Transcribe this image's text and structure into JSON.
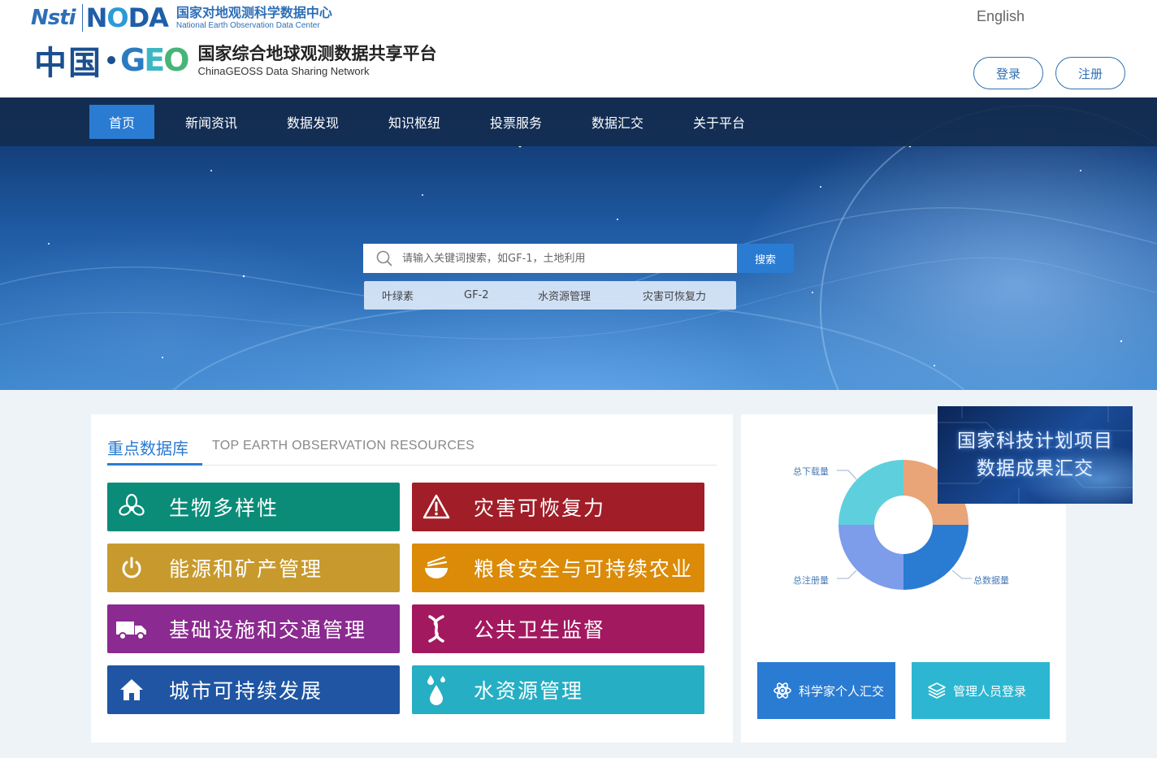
{
  "header": {
    "nsti_logo": "Nsti",
    "noda_logo": {
      "prefix": "N",
      "o": "O",
      "suffix": "DA"
    },
    "noda_cn": "国家对地观测科学数据中心",
    "noda_en": "National Earth Observation Data Center",
    "china_logo": "中国",
    "geo_logo": {
      "g": "G",
      "e": "E",
      "o": "O"
    },
    "geo_cn": "国家综合地球观测数据共享平台",
    "geo_en": "ChinaGEOSS Data Sharing Network",
    "language": "English",
    "login": "登录",
    "register": "注册"
  },
  "nav": {
    "items": [
      {
        "label": "首页",
        "active": true
      },
      {
        "label": "新闻资讯"
      },
      {
        "label": "数据发现"
      },
      {
        "label": "知识枢纽"
      },
      {
        "label": "投票服务"
      },
      {
        "label": "数据汇交"
      },
      {
        "label": "关于平台"
      }
    ]
  },
  "search": {
    "placeholder": "请输入关键词搜索，如GF-1，土地利用",
    "button": "搜索",
    "icon": "search-icon",
    "hot_tags": [
      "叶绿素",
      "GF-2",
      "水资源管理",
      "灾害可恢复力"
    ]
  },
  "resources": {
    "title": "重点数据库",
    "subtitle": "TOP EARTH OBSERVATION RESOURCES",
    "tiles": [
      {
        "label": "生物多样性",
        "color": "#0a8c78",
        "icon": "biodiversity-icon"
      },
      {
        "label": "灾害可恢复力",
        "color": "#a11d27",
        "icon": "warning-icon"
      },
      {
        "label": "能源和矿产管理",
        "color": "#c89a2e",
        "icon": "power-icon"
      },
      {
        "label": "粮食安全与可持续农业",
        "color": "#db8b07",
        "icon": "food-bowl-icon"
      },
      {
        "label": "基础设施和交通管理",
        "color": "#8b2a90",
        "icon": "truck-icon"
      },
      {
        "label": "公共卫生监督",
        "color": "#a3195f",
        "icon": "dna-icon"
      },
      {
        "label": "城市可持续发展",
        "color": "#1f55a3",
        "icon": "home-icon"
      },
      {
        "label": "水资源管理",
        "color": "#26aec4",
        "icon": "water-drops-icon"
      }
    ]
  },
  "stats": {
    "chart_data": {
      "type": "pie",
      "categories": [
        "总下载量",
        "总数据量",
        "总注册量"
      ],
      "colors": [
        "#5ed0dd",
        "#e9a477",
        "#2a7bd2",
        "#7d9cea"
      ]
    },
    "labels": {
      "downloads": "总下载量",
      "registrations": "总注册量",
      "data_volume": "总数据量"
    }
  },
  "banner": {
    "line1": "国家科技计划项目",
    "line2": "数据成果汇交"
  },
  "actions": {
    "scientist": "科学家个人汇交",
    "admin": "管理人员登录"
  }
}
